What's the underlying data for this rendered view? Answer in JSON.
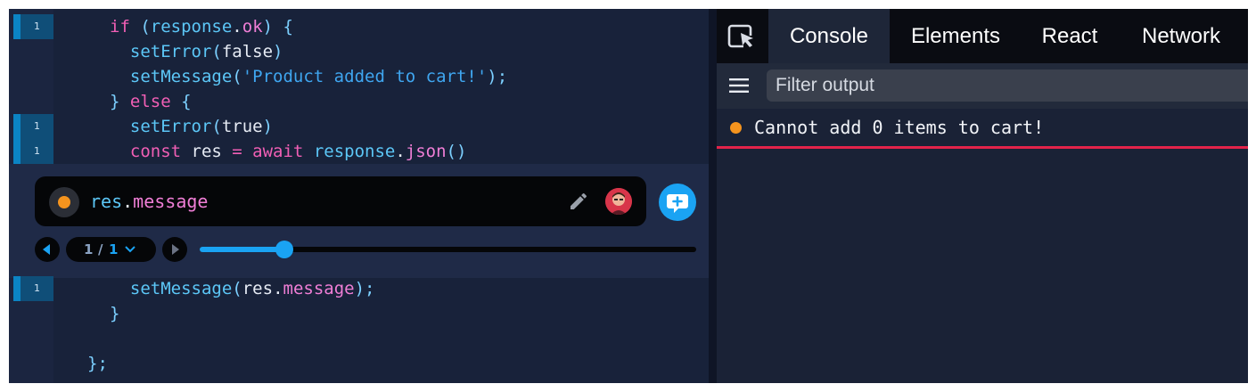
{
  "editor": {
    "lines_above": [
      {
        "hit_count": "1",
        "tokens": [
          [
            "kw",
            "if"
          ],
          [
            "punc",
            " ("
          ],
          [
            "fn",
            "response"
          ],
          [
            "plain",
            "."
          ],
          [
            "prop",
            "ok"
          ],
          [
            "punc",
            ") {"
          ]
        ]
      },
      {
        "hit_count": "",
        "tokens": [
          [
            "fn",
            "  setError"
          ],
          [
            "punc",
            "("
          ],
          [
            "plain",
            "false"
          ],
          [
            "punc",
            ")"
          ]
        ]
      },
      {
        "hit_count": "",
        "tokens": [
          [
            "fn",
            "  setMessage"
          ],
          [
            "punc",
            "("
          ],
          [
            "str",
            "'Product added to cart!'"
          ],
          [
            "punc",
            ");"
          ]
        ]
      },
      {
        "hit_count": "",
        "tokens": [
          [
            "punc",
            "} "
          ],
          [
            "kw",
            "else"
          ],
          [
            "punc",
            " {"
          ]
        ]
      },
      {
        "hit_count": "1",
        "tokens": [
          [
            "fn",
            "  setError"
          ],
          [
            "punc",
            "("
          ],
          [
            "plain",
            "true"
          ],
          [
            "punc",
            ")"
          ]
        ]
      },
      {
        "hit_count": "1",
        "tokens": [
          [
            "kw",
            "  const "
          ],
          [
            "plain",
            "res"
          ],
          [
            "kw",
            " = "
          ],
          [
            "kw",
            "await "
          ],
          [
            "fn",
            "response"
          ],
          [
            "plain",
            "."
          ],
          [
            "prop",
            "json"
          ],
          [
            "punc",
            "()"
          ]
        ]
      }
    ],
    "lines_below": [
      {
        "hit_count": "1",
        "tokens": [
          [
            "fn",
            "  setMessage"
          ],
          [
            "punc",
            "("
          ],
          [
            "plain",
            "res"
          ],
          [
            "plain",
            "."
          ],
          [
            "prop",
            "message"
          ],
          [
            "punc",
            ");"
          ]
        ]
      },
      {
        "hit_count": "",
        "tokens": [
          [
            "punc",
            "}"
          ]
        ]
      },
      {
        "hit_count": "",
        "tokens": []
      },
      {
        "hit_count": "",
        "tokens": [
          [
            "punc",
            "};"
          ]
        ]
      }
    ]
  },
  "print_panel": {
    "expression_object": "res",
    "expression_dot": ".",
    "expression_property": "message",
    "hit_current": "1",
    "hit_separator": "/",
    "hit_total": "1",
    "timeline_progress": 0.17,
    "colors": {
      "dot": "#f5941e",
      "accent": "#1aa3f3"
    }
  },
  "devtools": {
    "tabs": [
      {
        "label": "Console",
        "active": true
      },
      {
        "label": "Elements",
        "active": false
      },
      {
        "label": "React",
        "active": false
      },
      {
        "label": "Network",
        "active": false
      }
    ],
    "filter": {
      "placeholder": "Filter output",
      "value": ""
    },
    "log": {
      "text": "Cannot add 0 items to cart!",
      "level_color": "#f5941e",
      "underline_color": "#e3234a"
    }
  },
  "icons": {
    "inspect": "inspect-cursor-icon",
    "menu": "hamburger-menu-icon",
    "edit": "pencil-icon",
    "comment": "add-comment-icon",
    "prev": "previous-arrow-icon",
    "next": "next-arrow-icon",
    "pager_dropdown": "chevron-down-icon"
  }
}
